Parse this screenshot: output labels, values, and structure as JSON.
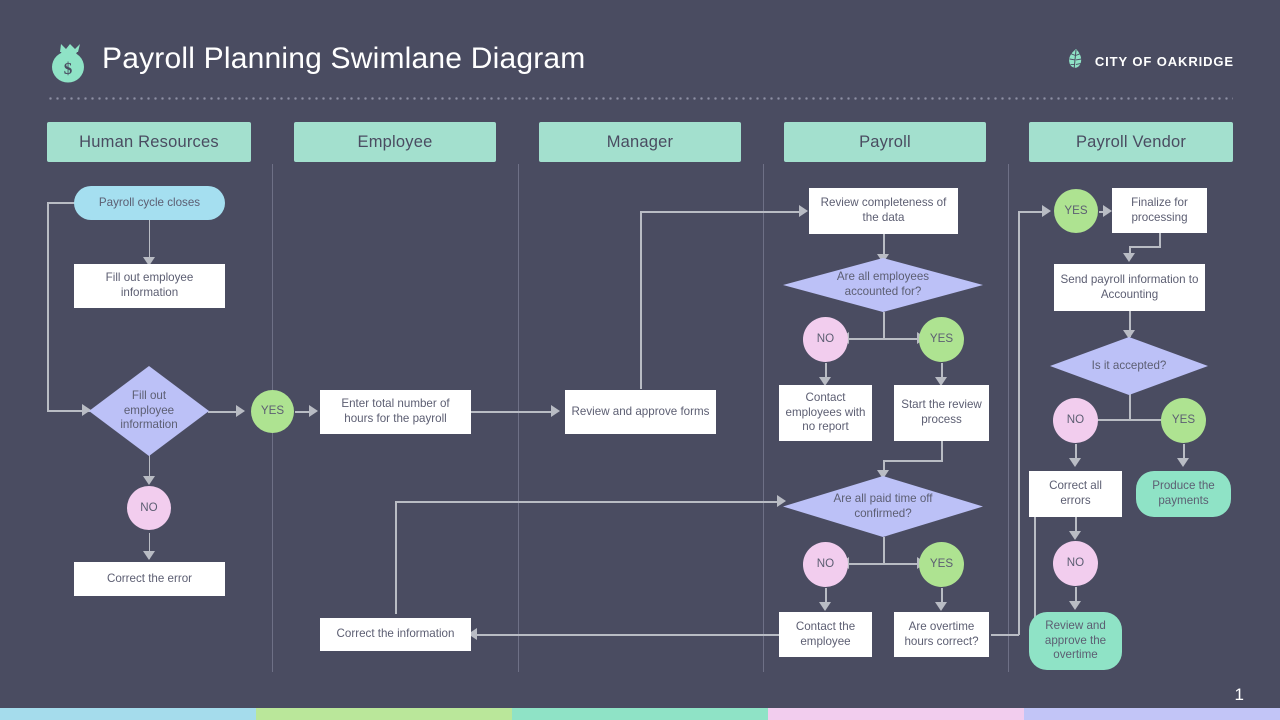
{
  "header": {
    "title": "Payroll Planning Swimlane Diagram",
    "logo_icon": "money-bag-icon",
    "brand_icon": "leaf-icon",
    "brand_name": "CITY OF OAKRIDGE"
  },
  "footer": {
    "page_number": "1",
    "color_bar": [
      "#a5dcec",
      "#bae79a",
      "#8fe3c6",
      "#f2cdee",
      "#c2c5f7"
    ]
  },
  "lanes": [
    {
      "label": "Human Resources"
    },
    {
      "label": "Employee"
    },
    {
      "label": "Manager"
    },
    {
      "label": "Payroll"
    },
    {
      "label": "Payroll Vendor"
    }
  ],
  "nodes": {
    "hr_start": {
      "label": "Payroll cycle closes",
      "shape": "rounded",
      "color": "#a5dff0"
    },
    "hr_fillout": {
      "label": "Fill out employee information",
      "shape": "rect",
      "color": "#ffffff"
    },
    "hr_decision": {
      "label": "Fill out employee information",
      "shape": "diamond",
      "color": "#bcc1f7"
    },
    "hr_yes": {
      "label": "YES",
      "shape": "circle",
      "color": "#aee391"
    },
    "hr_no": {
      "label": "NO",
      "shape": "circle",
      "color": "#f2cdee"
    },
    "hr_correct": {
      "label": "Correct the error",
      "shape": "rect",
      "color": "#ffffff"
    },
    "emp_hours": {
      "label": "Enter total number of hours for the payroll",
      "shape": "rect",
      "color": "#ffffff"
    },
    "emp_correct": {
      "label": "Correct the information",
      "shape": "rect",
      "color": "#ffffff"
    },
    "mgr_review": {
      "label": "Review and approve forms",
      "shape": "rect",
      "color": "#ffffff"
    },
    "pr_review": {
      "label": "Review completeness of the data",
      "shape": "rect",
      "color": "#ffffff"
    },
    "pr_dec1": {
      "label": "Are all employees accounted for?",
      "shape": "diamond",
      "color": "#bcc1f7"
    },
    "pr_no1": {
      "label": "NO",
      "shape": "circle",
      "color": "#f2cdee"
    },
    "pr_yes1": {
      "label": "YES",
      "shape": "circle",
      "color": "#aee391"
    },
    "pr_contact": {
      "label": "Contact employees with no report",
      "shape": "rect",
      "color": "#ffffff"
    },
    "pr_start": {
      "label": "Start the review process",
      "shape": "rect",
      "color": "#ffffff"
    },
    "pr_dec2": {
      "label": "Are all paid time off confirmed?",
      "shape": "diamond",
      "color": "#bcc1f7"
    },
    "pr_no2": {
      "label": "NO",
      "shape": "circle",
      "color": "#f2cdee"
    },
    "pr_yes2": {
      "label": "YES",
      "shape": "circle",
      "color": "#aee391"
    },
    "pr_contact2": {
      "label": "Contact the employee",
      "shape": "rect",
      "color": "#ffffff"
    },
    "pr_overtime": {
      "label": "Are overtime hours correct?",
      "shape": "rect",
      "color": "#ffffff"
    },
    "pv_yes0": {
      "label": "YES",
      "shape": "circle",
      "color": "#aee391"
    },
    "pv_finalize": {
      "label": "Finalize for processing",
      "shape": "rect",
      "color": "#ffffff"
    },
    "pv_send": {
      "label": "Send payroll information to Accounting",
      "shape": "rect",
      "color": "#ffffff"
    },
    "pv_dec": {
      "label": "Is it accepted?",
      "shape": "diamond",
      "color": "#bcc1f7"
    },
    "pv_no1": {
      "label": "NO",
      "shape": "circle",
      "color": "#f2cdee"
    },
    "pv_yes1": {
      "label": "YES",
      "shape": "circle",
      "color": "#aee391"
    },
    "pv_correct": {
      "label": "Correct all errors",
      "shape": "rect",
      "color": "#ffffff"
    },
    "pv_produce": {
      "label": "Produce the payments",
      "shape": "rounded",
      "color": "#8fe3c6"
    },
    "pv_no2": {
      "label": "NO",
      "shape": "circle",
      "color": "#f2cdee"
    },
    "pv_reviewot": {
      "label": "Review  and approve the overtime",
      "shape": "rounded",
      "color": "#8fe3c6"
    }
  }
}
